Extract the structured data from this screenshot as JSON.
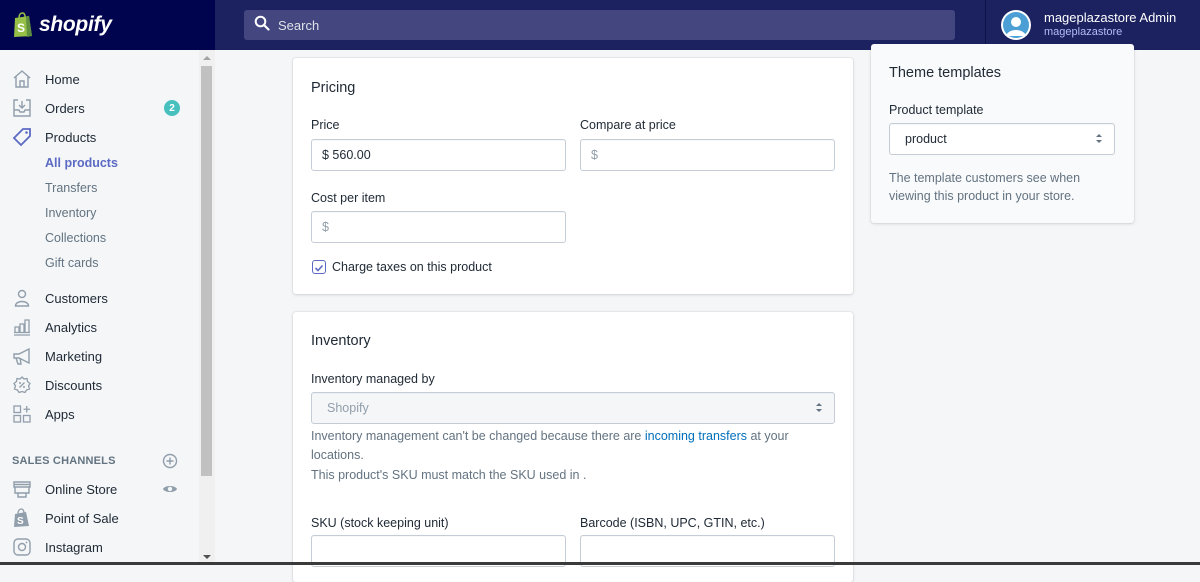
{
  "topbar": {
    "brand": "shopify",
    "search_placeholder": "Search",
    "account_name": "mageplazastore Admin",
    "account_store": "mageplazastore"
  },
  "sidebar": {
    "items": [
      {
        "label": "Home",
        "icon": "home-icon"
      },
      {
        "label": "Orders",
        "icon": "orders-icon",
        "badge": "2"
      },
      {
        "label": "Products",
        "icon": "tag-icon"
      },
      {
        "label": "Customers",
        "icon": "person-icon"
      },
      {
        "label": "Analytics",
        "icon": "bar-chart-icon"
      },
      {
        "label": "Marketing",
        "icon": "megaphone-icon"
      },
      {
        "label": "Discounts",
        "icon": "discount-icon"
      },
      {
        "label": "Apps",
        "icon": "apps-icon"
      }
    ],
    "product_subitems": [
      {
        "label": "All products",
        "active": true
      },
      {
        "label": "Transfers"
      },
      {
        "label": "Inventory"
      },
      {
        "label": "Collections"
      },
      {
        "label": "Gift cards"
      }
    ],
    "sales_channels_heading": "SALES CHANNELS",
    "channels": [
      {
        "label": "Online Store",
        "icon": "store-icon"
      },
      {
        "label": "Point of Sale",
        "icon": "pos-bag-icon"
      },
      {
        "label": "Instagram",
        "icon": "instagram-icon"
      }
    ]
  },
  "pricing": {
    "title": "Pricing",
    "price_label": "Price",
    "price_value": "$ 560.00",
    "compare_label": "Compare at price",
    "compare_placeholder": "$",
    "cost_label": "Cost per item",
    "cost_placeholder": "$",
    "charge_taxes_label": "Charge taxes on this product",
    "charge_taxes_checked": true
  },
  "inventory": {
    "title": "Inventory",
    "managed_by_label": "Inventory managed by",
    "managed_by_value": "Shopify",
    "help_prefix": "Inventory management can't be changed because there are ",
    "help_link": "incoming transfers",
    "help_suffix": " at your locations.",
    "sku_note": "This product's SKU must match the SKU used in .",
    "sku_label": "SKU (stock keeping unit)",
    "sku_value": "",
    "barcode_label": "Barcode (ISBN, UPC, GTIN, etc.)",
    "barcode_value": ""
  },
  "theme": {
    "title": "Theme templates",
    "template_label": "Product template",
    "template_value": "product",
    "help": "The template customers see when viewing this product in your store."
  },
  "colors": {
    "topbar": "#1c2260",
    "brand_bg": "#00034d",
    "accent": "#5c6ac4",
    "badge": "#47c1bf",
    "link": "#006fbb"
  }
}
